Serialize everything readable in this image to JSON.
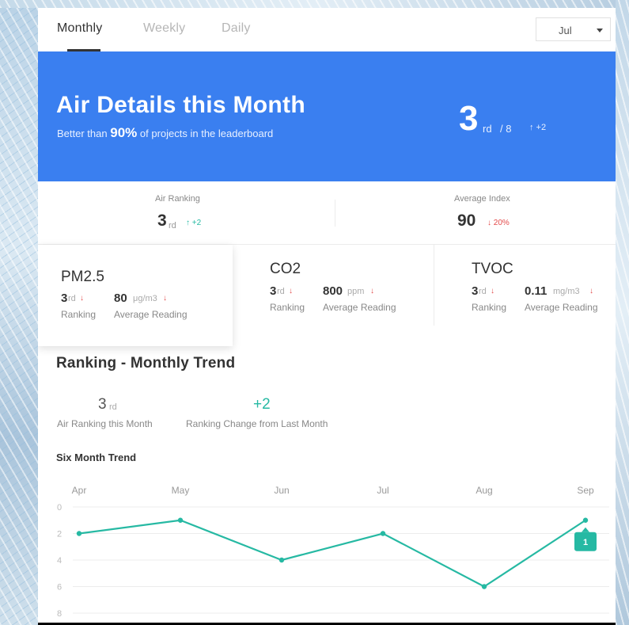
{
  "tabs": [
    {
      "label": "Monthly",
      "active": true
    },
    {
      "label": "Weekly",
      "active": false
    },
    {
      "label": "Daily",
      "active": false
    }
  ],
  "month_select": {
    "value": "Jul"
  },
  "hero": {
    "title": "Air Details this Month",
    "subtitle_pre": "Better than",
    "subtitle_pct": "90%",
    "subtitle_post": "of projects in the leaderboard",
    "rank": "3",
    "rank_suffix": "rd",
    "rank_total": "/ 8",
    "rank_change": "↑ +2"
  },
  "summary": {
    "air_ranking": {
      "label": "Air Ranking",
      "value": "3",
      "suffix": "rd",
      "change": "↑ +2"
    },
    "average_index": {
      "label": "Average Index",
      "value": "90",
      "change": "↓ 20%"
    }
  },
  "metrics": [
    {
      "name": "PM2.5",
      "rank": "3",
      "rank_suffix": "rd",
      "rank_label": "Ranking",
      "reading": "80",
      "unit": "μg/m3",
      "reading_label": "Average Reading"
    },
    {
      "name": "CO2",
      "rank": "3",
      "rank_suffix": "rd",
      "rank_label": "Ranking",
      "reading": "800",
      "unit": "ppm",
      "reading_label": "Average Reading"
    },
    {
      "name": "TVOC",
      "rank": "3",
      "rank_suffix": "rd",
      "rank_label": "Ranking",
      "reading": "0.11",
      "unit": "mg/m3",
      "reading_label": "Average Reading"
    }
  ],
  "trend": {
    "title": "Ranking - Monthly Trend",
    "air_rank_value": "3",
    "air_rank_suffix": "rd",
    "air_rank_label": "Air Ranking this Month",
    "change_value": "+2",
    "change_label": "Ranking Change from Last Month",
    "six_month_title": "Six Month Trend"
  },
  "colors": {
    "accent": "#3a7ff0",
    "teal": "#26b9a3",
    "down_red": "#e34a4a"
  },
  "chart_data": {
    "type": "line",
    "categories": [
      "Apr",
      "May",
      "Jun",
      "Jul",
      "Aug",
      "Sep"
    ],
    "series": [
      {
        "values": [
          2,
          1,
          4,
          2,
          6,
          1
        ]
      }
    ],
    "y_ticks": [
      0,
      2,
      4,
      6,
      8
    ],
    "ylim": [
      0,
      8
    ],
    "y_inverted": true,
    "grid": true,
    "highlight": {
      "category": "Sep",
      "label": "1"
    }
  }
}
